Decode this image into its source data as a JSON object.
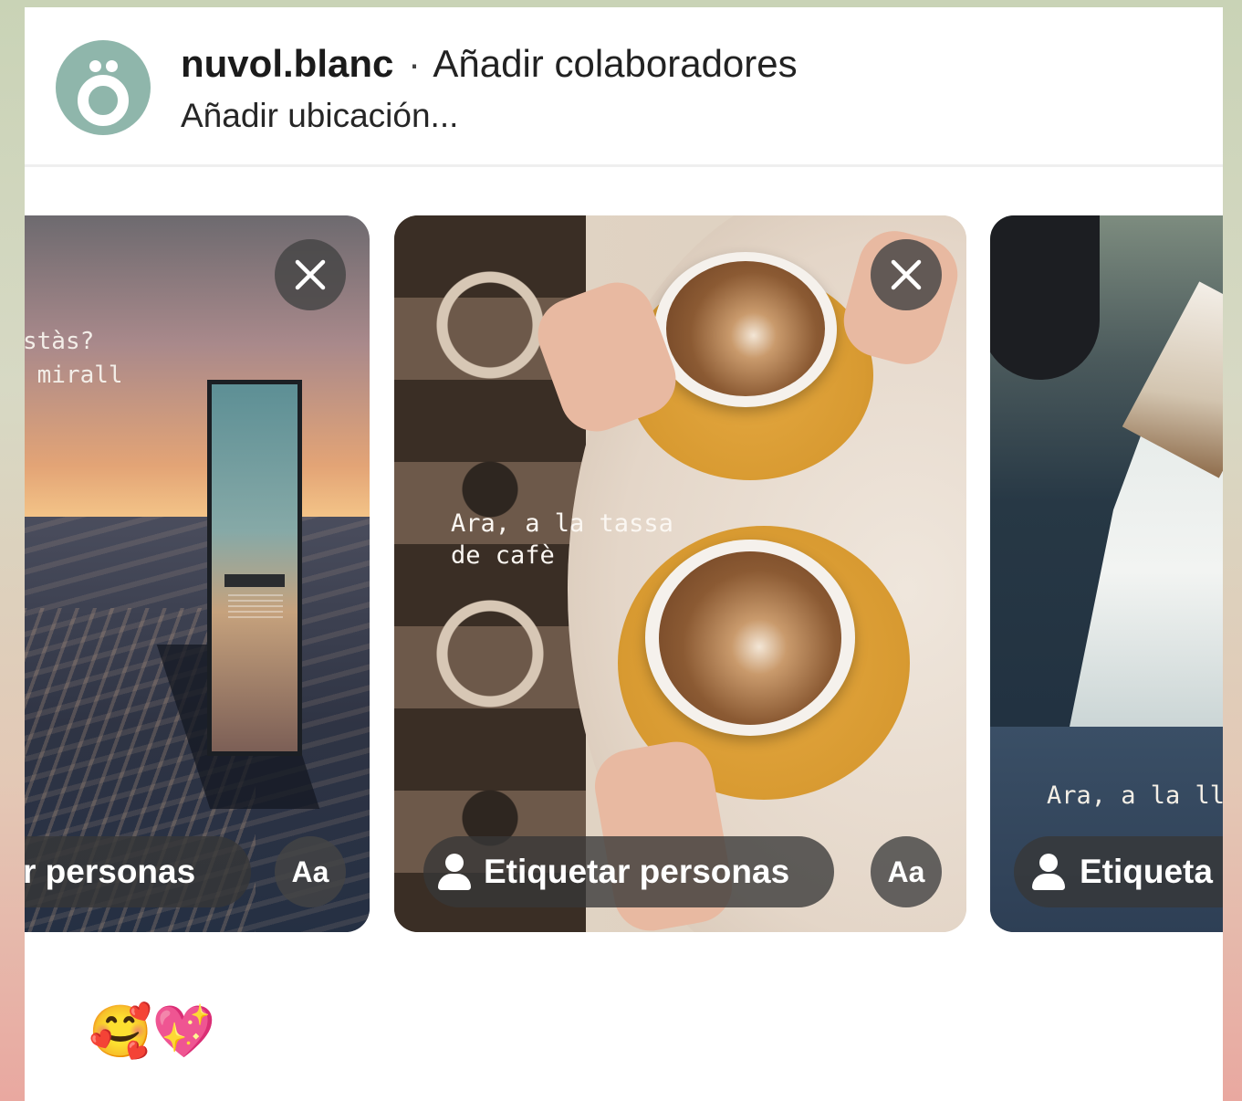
{
  "post": {
    "username": "nuvol.blanc",
    "separator": "·",
    "add_collaborators": "Añadir colaboradores",
    "add_location": "Añadir ubicación..."
  },
  "carousel": {
    "slides": [
      {
        "caption_lines": "stàs?\n mirall",
        "tag_label": "r personas",
        "text_tool": "Aa"
      },
      {
        "caption_lines": "Ara, a la tassa\nde cafè",
        "tag_label": "Etiquetar personas",
        "text_tool": "Aa"
      },
      {
        "caption_lines": "Ara, a la ll",
        "tag_label": "Etiqueta"
      }
    ]
  },
  "caption": {
    "emojis": "🥰💖"
  },
  "colors": {
    "avatar_bg": "#8fb6ab",
    "overlay_button": "#444444",
    "text_primary": "#222222"
  },
  "icons": [
    "avatar-logo",
    "close-icon",
    "person-icon"
  ]
}
